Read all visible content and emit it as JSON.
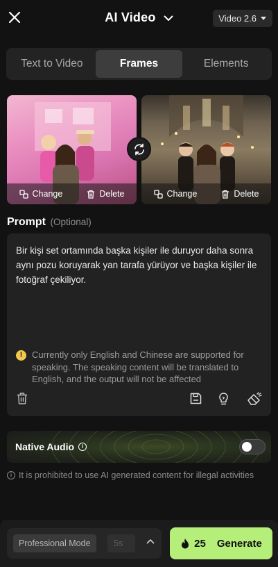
{
  "header": {
    "title": "AI Video",
    "version_label": "Video 2.6"
  },
  "tabs": [
    {
      "label": "Text to Video",
      "active": false
    },
    {
      "label": "Frames",
      "active": true
    },
    {
      "label": "Elements",
      "active": false
    }
  ],
  "frames": {
    "change_label": "Change",
    "delete_label": "Delete"
  },
  "prompt": {
    "label": "Prompt",
    "optional_label": "(Optional)",
    "text": "Bir kişi set ortamında başka kişiler ile duruyor daha sonra aynı pozu koruyarak yan tarafa yürüyor ve başka kişiler ile fotoğraf çekiliyor.",
    "warning": "Currently only English and Chinese are supported for speaking. The speaking content will be translated to English, and the output will not be affected"
  },
  "native_audio": {
    "label": "Native Audio",
    "enabled": false
  },
  "notice": "It is prohibited to use AI generated content for illegal activities",
  "bottom": {
    "mode_label": "Professional Mode",
    "duration_label": "5s",
    "cost": "25",
    "generate_label": "Generate"
  },
  "colors": {
    "accent": "#b6ee7a",
    "warning": "#f2c94c",
    "background": "#121212"
  },
  "icons": [
    "close-icon",
    "chevron-down-icon",
    "swap-icon",
    "change-image-icon",
    "trash-icon",
    "warning-icon",
    "save-icon",
    "lightbulb-icon",
    "eraser-icon",
    "info-icon",
    "flame-icon",
    "chevron-up-icon"
  ]
}
